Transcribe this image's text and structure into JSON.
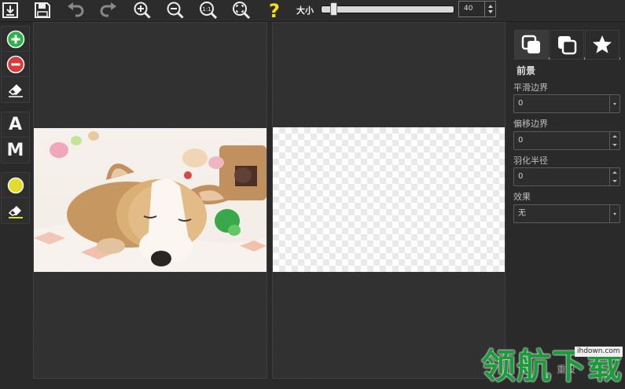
{
  "toolbar": {
    "size_label": "大小",
    "size_value": "40",
    "size_level": 0.06,
    "buttons": [
      "download-icon",
      "save-icon",
      "undo-icon",
      "redo-icon",
      "zoom-in-icon",
      "zoom-out-icon",
      "zoom-actual-icon",
      "zoom-fit-icon",
      "help-icon"
    ],
    "actual_size_text": "1:1",
    "help_text": "?"
  },
  "tools": {
    "add_icon": "plus-circle-icon",
    "remove_icon": "minus-circle-icon",
    "eraser_icon": "eraser-icon",
    "auto_label": "A",
    "manual_label": "M",
    "color_icon": "color-dot-icon",
    "color": "#e2dd2a",
    "eraser2_icon": "eraser-icon"
  },
  "canvas": {
    "left_image": "puppy-photo",
    "right_image": "transparent-result"
  },
  "panel": {
    "tabs": [
      "foreground-tab-icon",
      "background-tab-icon",
      "effects-tab-icon"
    ],
    "section_title": "前景",
    "fields": [
      {
        "label": "平滑边界",
        "value": "0",
        "kind": "dropdown"
      },
      {
        "label": "偏移边界",
        "value": "0",
        "kind": "spinner"
      },
      {
        "label": "羽化半径",
        "value": "0",
        "kind": "spinner"
      },
      {
        "label": "效果",
        "value": "无",
        "kind": "dropdown"
      }
    ],
    "reset_label": "重设"
  },
  "watermark": {
    "text": "领航下载",
    "url": "ihdown.com"
  },
  "colors": {
    "add": "#2bb34a",
    "remove": "#d93a3a",
    "watermark": "#1c9b3a",
    "help": "#f3df1a"
  }
}
